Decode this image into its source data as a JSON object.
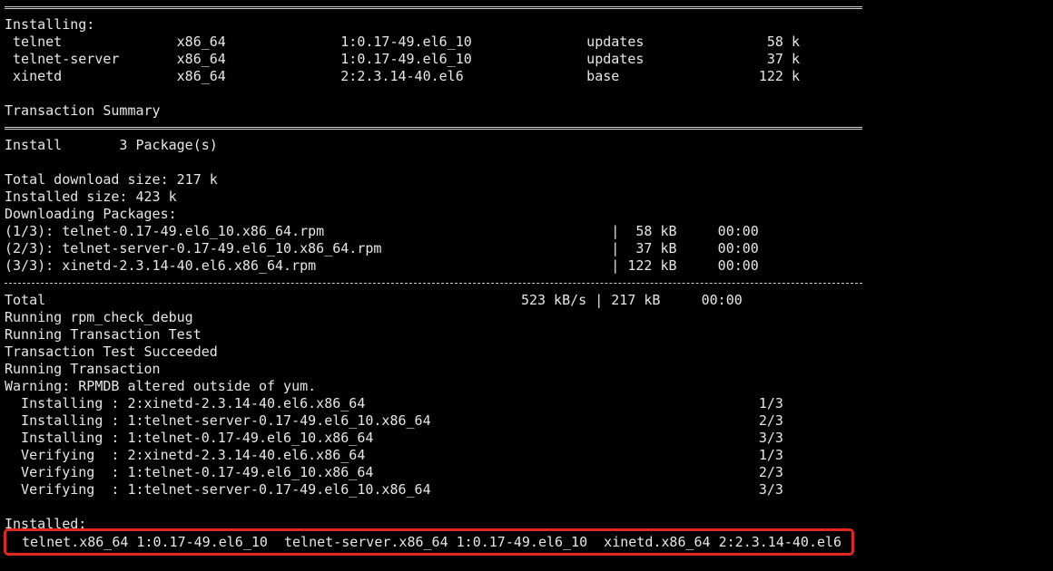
{
  "terminal": {
    "lines": [
      "",
      "Installing:",
      " telnet              x86_64              1:0.17-49.el6_10              updates               58 k",
      " telnet-server       x86_64              1:0.17-49.el6_10              updates               37 k",
      " xinetd              x86_64              2:2.3.14-40.el6               base                 122 k",
      "",
      "Transaction Summary",
      "",
      "Install       3 Package(s)",
      "",
      "Total download size: 217 k",
      "Installed size: 423 k",
      "Downloading Packages:",
      "(1/3): telnet-0.17-49.el6_10.x86_64.rpm                                   |  58 kB     00:00",
      "(2/3): telnet-server-0.17-49.el6_10.x86_64.rpm                            |  37 kB     00:00",
      "(3/3): xinetd-2.3.14-40.el6.x86_64.rpm                                    | 122 kB     00:00",
      "",
      "Total                                                          523 kB/s | 217 kB     00:00",
      "Running rpm_check_debug",
      "Running Transaction Test",
      "Transaction Test Succeeded",
      "Running Transaction",
      "Warning: RPMDB altered outside of yum.",
      "  Installing : 2:xinetd-2.3.14-40.el6.x86_64                                                1/3",
      "  Installing : 1:telnet-server-0.17-49.el6_10.x86_64                                        2/3",
      "  Installing : 1:telnet-0.17-49.el6_10.x86_64                                               3/3",
      "  Verifying  : 2:xinetd-2.3.14-40.el6.x86_64                                                1/3",
      "  Verifying  : 1:telnet-0.17-49.el6_10.x86_64                                               2/3",
      "  Verifying  : 1:telnet-server-0.17-49.el6_10.x86_64                                        3/3",
      "",
      "Installed:"
    ],
    "installed_packages": "telnet.x86_64 1:0.17-49.el6_10  telnet-server.x86_64 1:0.17-49.el6_10  xinetd.x86_64 2:2.3.14-40.el6"
  },
  "colors": {
    "background": "#000000",
    "text": "#e6e6e6",
    "highlight_border": "#e0281e"
  }
}
